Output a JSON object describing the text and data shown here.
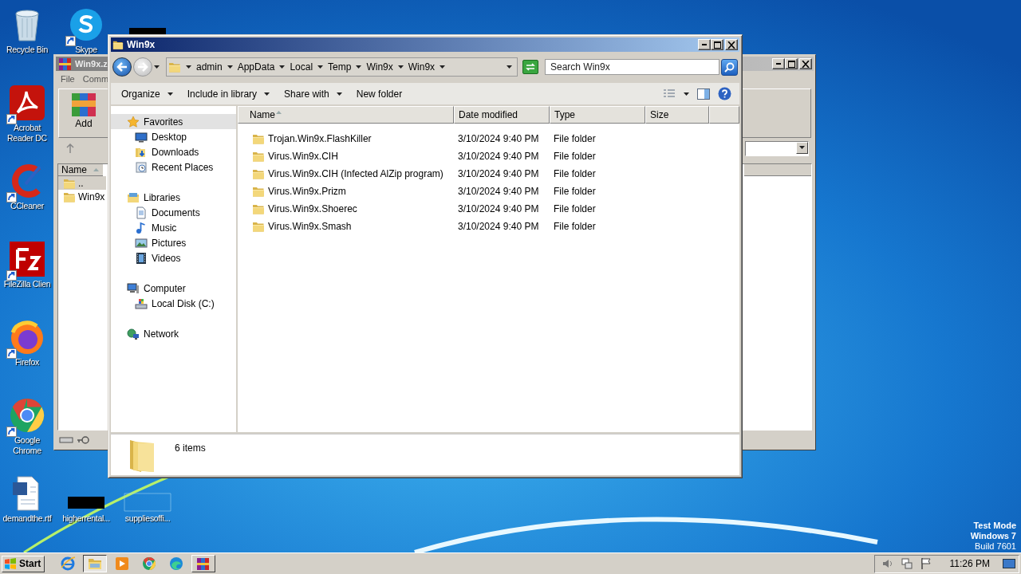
{
  "desktop": {
    "icons": [
      {
        "label": "Recycle Bin",
        "kind": "recycle",
        "shortcut": false
      },
      {
        "label": "Acrobat Reader DC",
        "kind": "acrobat",
        "shortcut": true
      },
      {
        "label": "CCleaner",
        "kind": "ccleaner",
        "shortcut": true
      },
      {
        "label": "FileZilla Clien",
        "kind": "filezilla",
        "shortcut": true
      },
      {
        "label": "Firefox",
        "kind": "firefox",
        "shortcut": true
      },
      {
        "label": "Google Chrome",
        "kind": "chrome",
        "shortcut": true
      },
      {
        "label": "demandthe.rtf",
        "kind": "word",
        "shortcut": false
      },
      {
        "label": "Skype",
        "kind": "skype",
        "shortcut": true
      },
      {
        "label": "higherrental...",
        "kind": "redacted",
        "shortcut": false
      },
      {
        "kind": "redacted"
      },
      {
        "label": "suppliesoffi...",
        "kind": "blank",
        "shortcut": false
      }
    ],
    "system_notice": [
      "Test Mode",
      "Windows 7",
      "Build 7601"
    ]
  },
  "archive_window": {
    "title": "Win9x.z",
    "menu": [
      "File",
      "Comm"
    ],
    "toolbar": [
      {
        "label": "Add"
      }
    ],
    "columns": [
      {
        "label": "Name",
        "sorted": true
      }
    ],
    "rows": [
      {
        "name": "..",
        "selected": true
      },
      {
        "name": "Win9x",
        "selected": false
      }
    ]
  },
  "explorer": {
    "title": "Win9x",
    "breadcrumb": [
      "admin",
      "AppData",
      "Local",
      "Temp",
      "Win9x",
      "Win9x"
    ],
    "search": {
      "placeholder": "Search Win9x"
    },
    "commands": [
      {
        "label": "Organize",
        "menu": true
      },
      {
        "label": "Include in library",
        "menu": true
      },
      {
        "label": "Share with",
        "menu": true
      },
      {
        "label": "New folder",
        "menu": false
      }
    ],
    "nav": [
      {
        "label": "Favorites",
        "kind": "star",
        "selected": true,
        "children": [
          {
            "label": "Desktop",
            "kind": "desktop",
            "selected": false
          },
          {
            "label": "Downloads",
            "kind": "downloads",
            "selected": false
          },
          {
            "label": "Recent Places",
            "kind": "recent",
            "selected": false
          }
        ]
      },
      {
        "label": "Libraries",
        "kind": "library",
        "selected": false,
        "children": [
          {
            "label": "Documents",
            "kind": "documents",
            "selected": false
          },
          {
            "label": "Music",
            "kind": "music",
            "selected": false
          },
          {
            "label": "Pictures",
            "kind": "pictures",
            "selected": false
          },
          {
            "label": "Videos",
            "kind": "videos",
            "selected": false
          }
        ]
      },
      {
        "label": "Computer",
        "kind": "computer",
        "selected": false,
        "children": [
          {
            "label": "Local Disk (C:)",
            "kind": "disk",
            "selected": false
          }
        ]
      },
      {
        "label": "Network",
        "kind": "network",
        "selected": false
      }
    ],
    "columns": [
      {
        "label": "Name",
        "sorted": true
      },
      {
        "label": "Date modified",
        "sorted": false
      },
      {
        "label": "Type",
        "sorted": false
      },
      {
        "label": "Size",
        "sorted": false
      }
    ],
    "rows": [
      {
        "name": "Trojan.Win9x.FlashKiller",
        "date": "3/10/2024 9:40 PM",
        "type": "File folder"
      },
      {
        "name": "Virus.Win9x.CIH",
        "date": "3/10/2024 9:40 PM",
        "type": "File folder"
      },
      {
        "name": "Virus.Win9x.CIH (Infected AlZip program)",
        "date": "3/10/2024 9:40 PM",
        "type": "File folder"
      },
      {
        "name": "Virus.Win9x.Prizm",
        "date": "3/10/2024 9:40 PM",
        "type": "File folder"
      },
      {
        "name": "Virus.Win9x.Shoerec",
        "date": "3/10/2024 9:40 PM",
        "type": "File folder"
      },
      {
        "name": "Virus.Win9x.Smash",
        "date": "3/10/2024 9:40 PM",
        "type": "File folder"
      }
    ],
    "details": {
      "count": "6 items"
    }
  },
  "taskbar": {
    "start": "Start",
    "apps": [
      {
        "kind": "ie",
        "open": false,
        "active": false
      },
      {
        "kind": "explorer",
        "open": true,
        "active": true
      },
      {
        "kind": "media",
        "open": false,
        "active": false
      },
      {
        "kind": "chrome",
        "open": false,
        "active": false
      },
      {
        "kind": "edge",
        "open": false,
        "active": false
      },
      {
        "kind": "winrar",
        "open": true,
        "active": false
      }
    ],
    "time": "11:26 PM"
  }
}
